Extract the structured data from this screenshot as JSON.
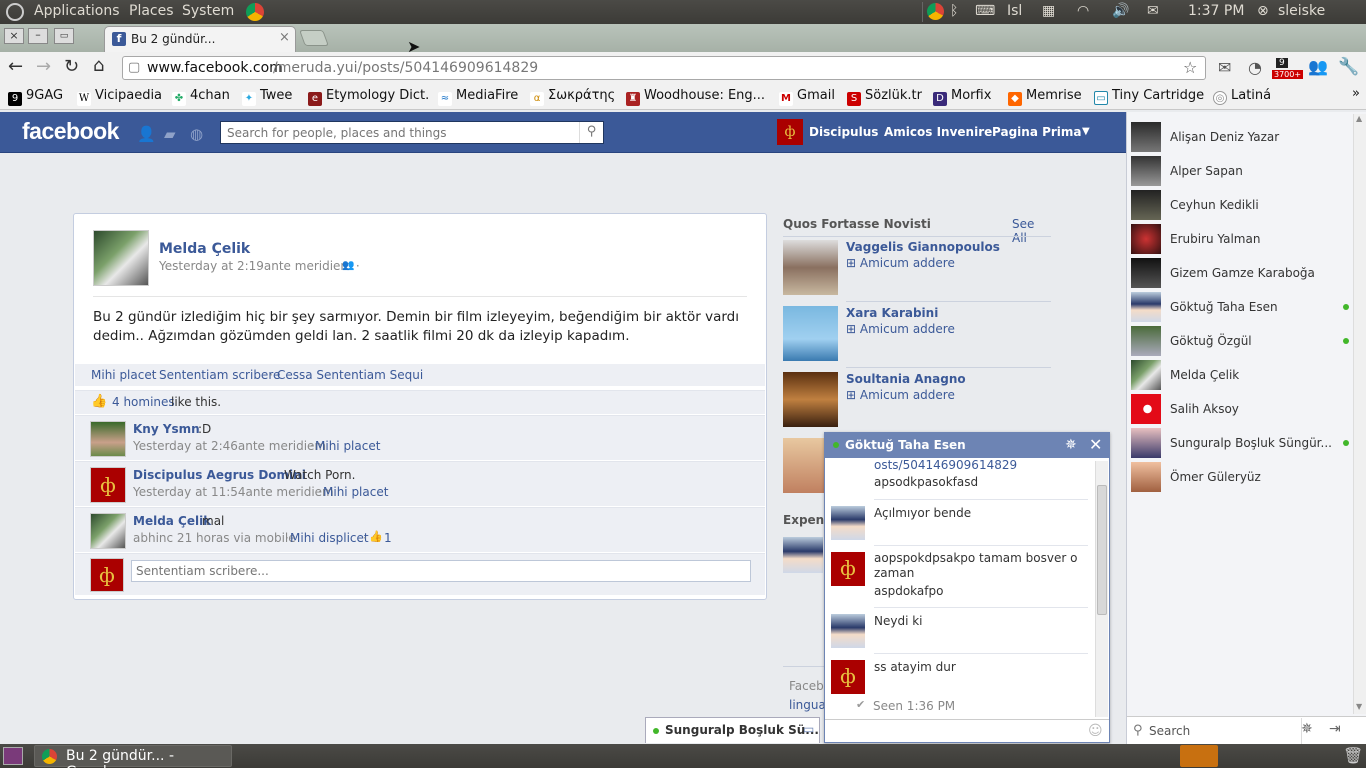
{
  "panel": {
    "menus": [
      "Applications",
      "Places",
      "System"
    ],
    "keyboard": "Isl",
    "clock": "1:37 PM",
    "user": "sleiske"
  },
  "tab": {
    "title": "Bu 2 gündür..."
  },
  "url": {
    "domain": "www.facebook.com",
    "path": "/meruda.yui/posts/504146909614829"
  },
  "ext_badges": {
    "count1": "9",
    "count2": "3700+"
  },
  "bookmarks": [
    "9GAG",
    "Vicipaedia",
    "4chan",
    "Twee",
    "Etymology Dict.",
    "MediaFire",
    "Σωκράτης",
    "Woodhouse: Eng...",
    "Gmail",
    "Sözlük.tr",
    "Morfix",
    "Memrise",
    "Tiny Cartridge",
    "Latiná"
  ],
  "fb": {
    "logo": "facebook",
    "search_placeholder": "Search for people, places and things",
    "nav": [
      "Discipulus",
      "Amicos Invenire",
      "Pagina Prima"
    ]
  },
  "post": {
    "author": "Melda Çelik",
    "time": "Yesterday at 2:19ante meridiem ·",
    "text": "Bu 2 gündür izlediğim hiç bir şey sarmıyor. Demin bir film izleyeyim, beğendiğim bir aktör vardı dedim.. Ağzımdan gözümden geldi lan. 2 saatlik filmi 20 dk da izleyip kapadım.",
    "actions": {
      "like": "Mihi placet",
      "comment": "Sententiam scribere",
      "unfollow": "Cessa Sententiam Sequi",
      "sep": " · "
    },
    "likes": {
      "count": "4 homines",
      "suffix": " like this."
    },
    "comments": [
      {
        "author": "Kny Ysmn",
        "text": ":D",
        "time": "Yesterday at 2:46ante meridiem",
        "action": "Mihi placet"
      },
      {
        "author": "Discipulus Aegrus Domini",
        "text": "Watch Porn.",
        "time": "Yesterday at 11:54ante meridiem",
        "action": "Mihi placet"
      },
      {
        "author": "Melda Çelik",
        "text": "mal",
        "time": "abhinc 21 horas via mobile",
        "action": "Mihi displicet",
        "likes": "1"
      }
    ],
    "comment_placeholder": "Sententiam scribere..."
  },
  "suggestions": {
    "title": "Quos Fortasse Novisti",
    "see_all": "See All",
    "add_label": "Amicum addere",
    "people": [
      "Vaggelis Giannopoulos",
      "Xara Karabini",
      "Soultania Anagno"
    ],
    "expens": "Expens",
    "footer1": "Faceb",
    "footer2": "lingua"
  },
  "chat": {
    "name": "Göktuğ Taha Esen",
    "messages": [
      {
        "lines": [
          "osts/504146909614829",
          "apsodkpasokfasd"
        ]
      },
      {
        "lines": [
          "Açılmıyor bende"
        ]
      },
      {
        "lines": [
          "aopspokdpsakpo tamam bosver o zaman",
          "aspdokafpo"
        ]
      },
      {
        "lines": [
          "Neydi ki"
        ]
      },
      {
        "lines": [
          "ss atayim dur"
        ]
      }
    ],
    "seen": "Seen 1:36 PM"
  },
  "minichat": {
    "name": "Sunguralp Boşluk Sü..."
  },
  "sidebar": {
    "friends": [
      {
        "name": "Alişan Deniz Yazar",
        "online": false
      },
      {
        "name": "Alper Sapan",
        "online": false
      },
      {
        "name": "Ceyhun Kedikli",
        "online": false
      },
      {
        "name": "Erubiru Yalman",
        "online": false
      },
      {
        "name": "Gizem Gamze Karaboğa",
        "online": false
      },
      {
        "name": "Göktuğ Taha Esen",
        "online": true
      },
      {
        "name": "Göktuğ Özgül",
        "online": true
      },
      {
        "name": "Melda Çelik",
        "online": false
      },
      {
        "name": "Salih Aksoy",
        "online": false
      },
      {
        "name": "Sunguralp Boşluk Süngür...",
        "online": true
      },
      {
        "name": "Ömer Güleryüz",
        "online": false
      }
    ],
    "search_label": "Search"
  },
  "taskbar": {
    "window": "Bu 2 gündür... - Google..."
  },
  "colors": {
    "fb_blue": "#3b5998",
    "online": "#42b72a",
    "panel": "#3c3b37"
  }
}
